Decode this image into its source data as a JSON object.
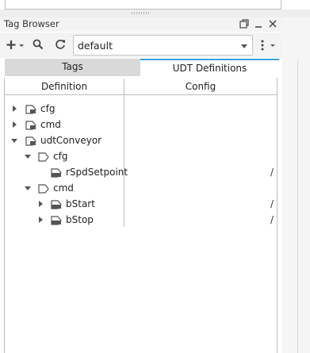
{
  "panel": {
    "title": "Tag Browser"
  },
  "toolbar": {
    "provider_value": "default",
    "icons": [
      "add-icon",
      "search-icon",
      "refresh-icon",
      "more-icon"
    ]
  },
  "tabs": [
    {
      "label": "Tags",
      "active": false
    },
    {
      "label": "UDT Definitions",
      "active": true
    }
  ],
  "table": {
    "columns": [
      "Definition",
      "Config"
    ],
    "rows": [
      {
        "label": "cfg",
        "config": ""
      },
      {
        "label": "cmd",
        "config": ""
      },
      {
        "label": "udtConveyor",
        "config": ""
      },
      {
        "label": "cfg",
        "config": ""
      },
      {
        "label": "rSpdSetpoint",
        "config": "/"
      },
      {
        "label": "cmd",
        "config": ""
      },
      {
        "label": "bStart",
        "config": "/"
      },
      {
        "label": "bStop",
        "config": "/"
      }
    ]
  },
  "colors": {
    "accent": "#3aa0de",
    "inactive_tab": "#d9d9d9",
    "toolbar_bg": "#f3f3f3"
  }
}
